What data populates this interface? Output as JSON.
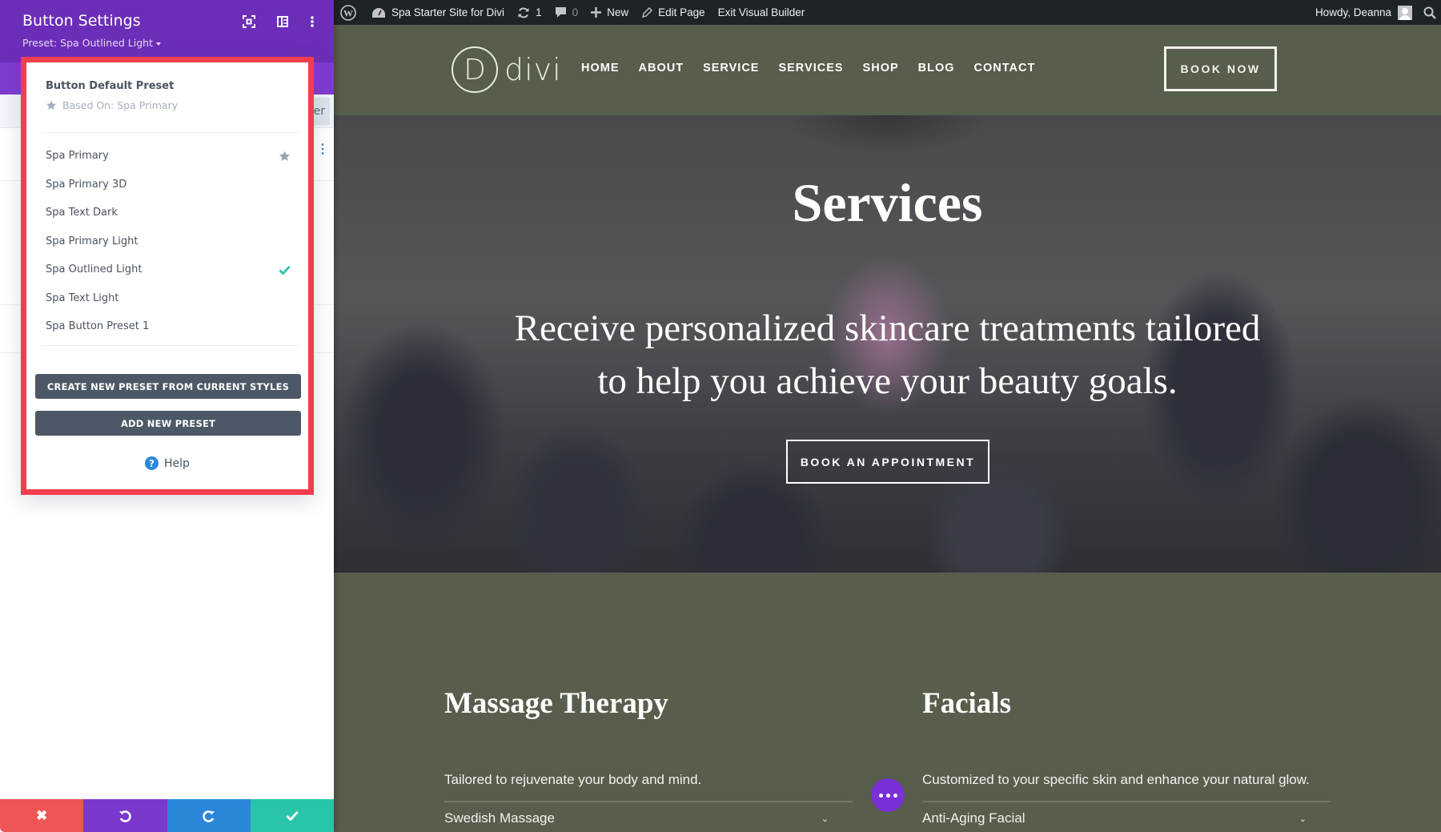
{
  "panel": {
    "title": "Button Settings",
    "preset_label": "Preset: Spa Outlined Light",
    "header_icons": [
      "expand-icon",
      "layout-icon",
      "kebab-menu-icon"
    ],
    "background_tab_partial": "er",
    "actions": {
      "cancel": {
        "icon": "close-icon",
        "color": "#ef5555"
      },
      "undo": {
        "icon": "undo-icon",
        "color": "#7b38cd"
      },
      "redo": {
        "icon": "redo-icon",
        "color": "#2b87da"
      },
      "save": {
        "icon": "check-icon",
        "color": "#29c4a9"
      }
    }
  },
  "preset_dropdown": {
    "highlight_color": "#f23d4e",
    "default_preset": {
      "title": "Button Default Preset",
      "based_on": "Based On: Spa Primary"
    },
    "presets": [
      {
        "label": "Spa Primary",
        "mark": "star"
      },
      {
        "label": "Spa Primary 3D",
        "mark": ""
      },
      {
        "label": "Spa Text Dark",
        "mark": ""
      },
      {
        "label": "Spa Primary Light",
        "mark": ""
      },
      {
        "label": "Spa Outlined Light",
        "mark": "check"
      },
      {
        "label": "Spa Text Light",
        "mark": ""
      },
      {
        "label": "Spa Button Preset 1",
        "mark": ""
      }
    ],
    "create_button": "CREATE NEW PRESET FROM CURRENT STYLES",
    "add_button": "ADD NEW PRESET",
    "help_label": "Help"
  },
  "adminbar": {
    "site_name": "Spa Starter Site for Divi",
    "updates_count": "1",
    "comments_count": "0",
    "new_label": "New",
    "edit_label": "Edit Page",
    "exit_label": "Exit Visual Builder",
    "greeting": "Howdy, Deanna"
  },
  "site": {
    "logo_letter": "D",
    "logo_text": "divi",
    "nav": [
      "HOME",
      "ABOUT",
      "SERVICE",
      "SERVICES",
      "SHOP",
      "BLOG",
      "CONTACT"
    ],
    "book_now": "BOOK NOW",
    "hero": {
      "title": "Services",
      "subtitle_line1": "Receive personalized skincare treatments tailored",
      "subtitle_line2": "to help you achieve your beauty goals.",
      "cta": "BOOK AN APPOINTMENT"
    },
    "services": [
      {
        "title": "Massage Therapy",
        "description": "Tailored to rejuvenate your body and mind.",
        "first_item": "Swedish Massage"
      },
      {
        "title": "Facials",
        "description": "Customized to your specific skin and enhance your natural glow.",
        "first_item": "Anti-Aging Facial"
      }
    ],
    "section_bg": "#575e4b"
  }
}
